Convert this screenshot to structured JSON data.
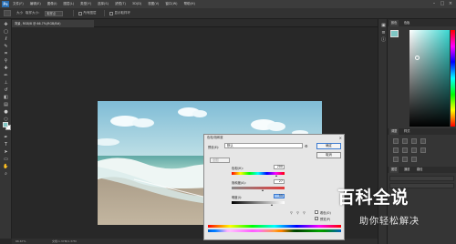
{
  "menubar": {
    "app_logo": "Ps",
    "items": [
      "文件(F)",
      "编辑(E)",
      "图像(I)",
      "图层(L)",
      "类型(Y)",
      "选择(S)",
      "滤镜(T)",
      "3D(D)",
      "视图(V)",
      "窗口(W)",
      "帮助(H)"
    ],
    "window_controls": [
      "–",
      "□",
      "×"
    ]
  },
  "options_bar": {
    "brush_size_label": "大小",
    "sample_label": "取样大小：",
    "sample_value": "取样点",
    "sample_all_label": "所有图层",
    "show_ring_label": "显示取样环"
  },
  "document": {
    "tab_title": "背景, RGB/8 @ 66.7%(RGB/8#)",
    "zoom": "66.67%",
    "doc_info": "文档:1.37M/1.37M"
  },
  "tools": {
    "icons": [
      "move-icon",
      "marquee-icon",
      "lasso-icon",
      "quick-select-icon",
      "crop-icon",
      "eyedropper-icon",
      "healing-icon",
      "brush-icon",
      "stamp-icon",
      "history-brush-icon",
      "eraser-icon",
      "gradient-icon",
      "blur-icon",
      "dodge-icon",
      "pen-icon",
      "type-icon",
      "path-select-icon",
      "shape-icon",
      "hand-icon",
      "zoom-icon"
    ],
    "foreground_color": "#7fc6c4",
    "background_color": "#ffffff"
  },
  "panels": {
    "color_tabs": [
      "颜色",
      "色板"
    ],
    "adjust_tabs": [
      "调整",
      "样式"
    ],
    "layers_tabs": [
      "图层",
      "通道",
      "路径"
    ]
  },
  "dialog": {
    "title": "色相/饱和度",
    "preset_label": "预设(E):",
    "preset_value": "默认",
    "channel_value": "全图",
    "hue_label": "色相(H):",
    "hue_value": "200",
    "saturation_label": "饱和度(A):",
    "saturation_value": "27",
    "lightness_label": "明度(I):",
    "lightness_value": "55",
    "ok_label": "确定",
    "cancel_label": "取消",
    "colorize_label": "着色(O)",
    "preview_label": "预览(P)",
    "hue_level": 0.85,
    "saturation_level": 0.6,
    "lightness_level": 0.77
  },
  "watermark": {
    "main": "百科全说",
    "sub": "助你轻松解决"
  }
}
